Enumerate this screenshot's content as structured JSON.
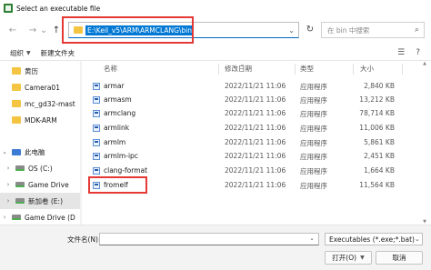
{
  "window": {
    "title": "Select an executable file"
  },
  "nav": {
    "back": "←",
    "forward": "→",
    "dropdown": "⌄",
    "up": "↑"
  },
  "address": {
    "path": "E:\\Keil_v5\\ARM\\ARMCLANG\\bin",
    "refresh": "↻"
  },
  "search": {
    "placeholder": "在 bin 中搜索",
    "icon": "search-icon"
  },
  "toolbar": {
    "organize_label": "组织",
    "new_folder_label": "新建文件夹",
    "view_icon": "☰",
    "help_icon": "?"
  },
  "columns": {
    "name": "名称",
    "date": "修改日期",
    "type": "类型",
    "size": "大小"
  },
  "sidebar": {
    "items": [
      {
        "label": "黄历",
        "icon": "folder-icon"
      },
      {
        "label": "Camera01",
        "icon": "folder-icon"
      },
      {
        "label": "mc_gd32-mast",
        "icon": "folder-icon"
      },
      {
        "label": "MDK-ARM",
        "icon": "folder-icon"
      },
      {
        "label": "此电脑",
        "icon": "computer-icon"
      },
      {
        "label": "OS (C:)",
        "icon": "drive-icon"
      },
      {
        "label": "Game Drive",
        "icon": "drive-icon"
      },
      {
        "label": "新加卷 (E:)",
        "icon": "drive-icon"
      },
      {
        "label": "Game Drive (D",
        "icon": "drive-icon"
      }
    ]
  },
  "files": [
    {
      "name": "armar",
      "date": "2022/11/21 11:06",
      "type": "应用程序",
      "size": "2,840 KB"
    },
    {
      "name": "armasm",
      "date": "2022/11/21 11:06",
      "type": "应用程序",
      "size": "13,212 KB"
    },
    {
      "name": "armclang",
      "date": "2022/11/21 11:06",
      "type": "应用程序",
      "size": "78,714 KB"
    },
    {
      "name": "armlink",
      "date": "2022/11/21 11:06",
      "type": "应用程序",
      "size": "11,006 KB"
    },
    {
      "name": "armlm",
      "date": "2022/11/21 11:06",
      "type": "应用程序",
      "size": "5,861 KB"
    },
    {
      "name": "armlm-ipc",
      "date": "2022/11/21 11:06",
      "type": "应用程序",
      "size": "2,451 KB"
    },
    {
      "name": "clang-format",
      "date": "2022/11/21 11:06",
      "type": "应用程序",
      "size": "1,664 KB"
    },
    {
      "name": "fromelf",
      "date": "2022/11/21 11:06",
      "type": "应用程序",
      "size": "11,564 KB"
    }
  ],
  "bottom": {
    "filename_label": "文件名(N):",
    "filename_value": "",
    "filetype_value": "Executables (*.exe;*.bat)",
    "open_label": "打开(O)",
    "cancel_label": "取消"
  },
  "colors": {
    "accent": "#0078d4",
    "highlight_box": "#e53935",
    "folder": "#f4c542"
  }
}
